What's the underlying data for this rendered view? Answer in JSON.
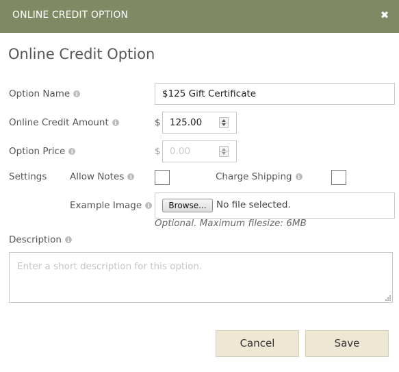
{
  "header": {
    "title": "ONLINE CREDIT OPTION",
    "close_glyph": "✖"
  },
  "heading": "Online Credit Option",
  "form": {
    "option_name": {
      "label": "Option Name",
      "value": "$125 Gift Certificate"
    },
    "credit_amount": {
      "label": "Online Credit Amount",
      "currency": "$",
      "value": "125.00"
    },
    "option_price": {
      "label": "Option Price",
      "currency": "$",
      "placeholder": "0.00"
    },
    "settings": {
      "label": "Settings",
      "allow_notes": {
        "label": "Allow Notes",
        "checked": false
      },
      "charge_shipping": {
        "label": "Charge Shipping",
        "checked": false
      }
    },
    "example_image": {
      "label": "Example Image",
      "browse_label": "Browse...",
      "file_status": "No file selected.",
      "hint": "Optional. Maximum filesize: 6MB"
    },
    "description": {
      "label": "Description",
      "placeholder": "Enter a short description for this option."
    }
  },
  "buttons": {
    "cancel": "Cancel",
    "save": "Save"
  },
  "info_glyph": "i",
  "colors": {
    "titlebar": "#7f8a64",
    "button_bg": "#ede7d4",
    "text": "#555555"
  }
}
